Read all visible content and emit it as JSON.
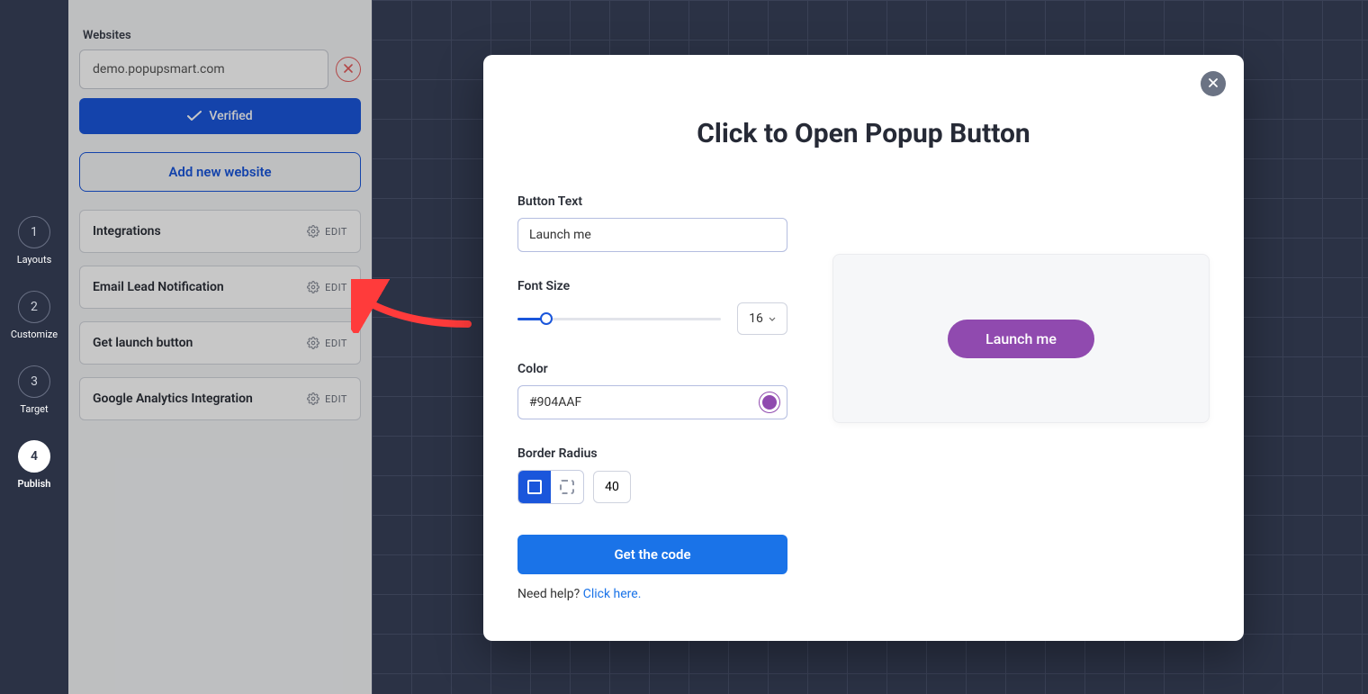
{
  "vnav": [
    {
      "num": "1",
      "label": "Layouts",
      "active": false
    },
    {
      "num": "2",
      "label": "Customize",
      "active": false
    },
    {
      "num": "3",
      "label": "Target",
      "active": false
    },
    {
      "num": "4",
      "label": "Publish",
      "active": true
    }
  ],
  "sidebar": {
    "websites_label": "Websites",
    "website_value": "demo.popupsmart.com",
    "verified_label": "Verified",
    "add_label": "Add new website",
    "rows": [
      {
        "label": "Integrations",
        "edit": "EDIT"
      },
      {
        "label": "Email Lead Notification",
        "edit": "EDIT"
      },
      {
        "label": "Get launch button",
        "edit": "EDIT"
      },
      {
        "label": "Google Analytics Integration",
        "edit": "EDIT"
      }
    ]
  },
  "modal": {
    "title": "Click to Open Popup Button",
    "button_text_label": "Button Text",
    "button_text_value": "Launch me",
    "font_size_label": "Font Size",
    "font_size_value": "16",
    "color_label": "Color",
    "color_value": "#904AAF",
    "radius_label": "Border Radius",
    "radius_value": "40",
    "get_code_label": "Get the code",
    "help_prefix": "Need help? ",
    "help_link": "Click here.",
    "preview_button": "Launch me"
  }
}
